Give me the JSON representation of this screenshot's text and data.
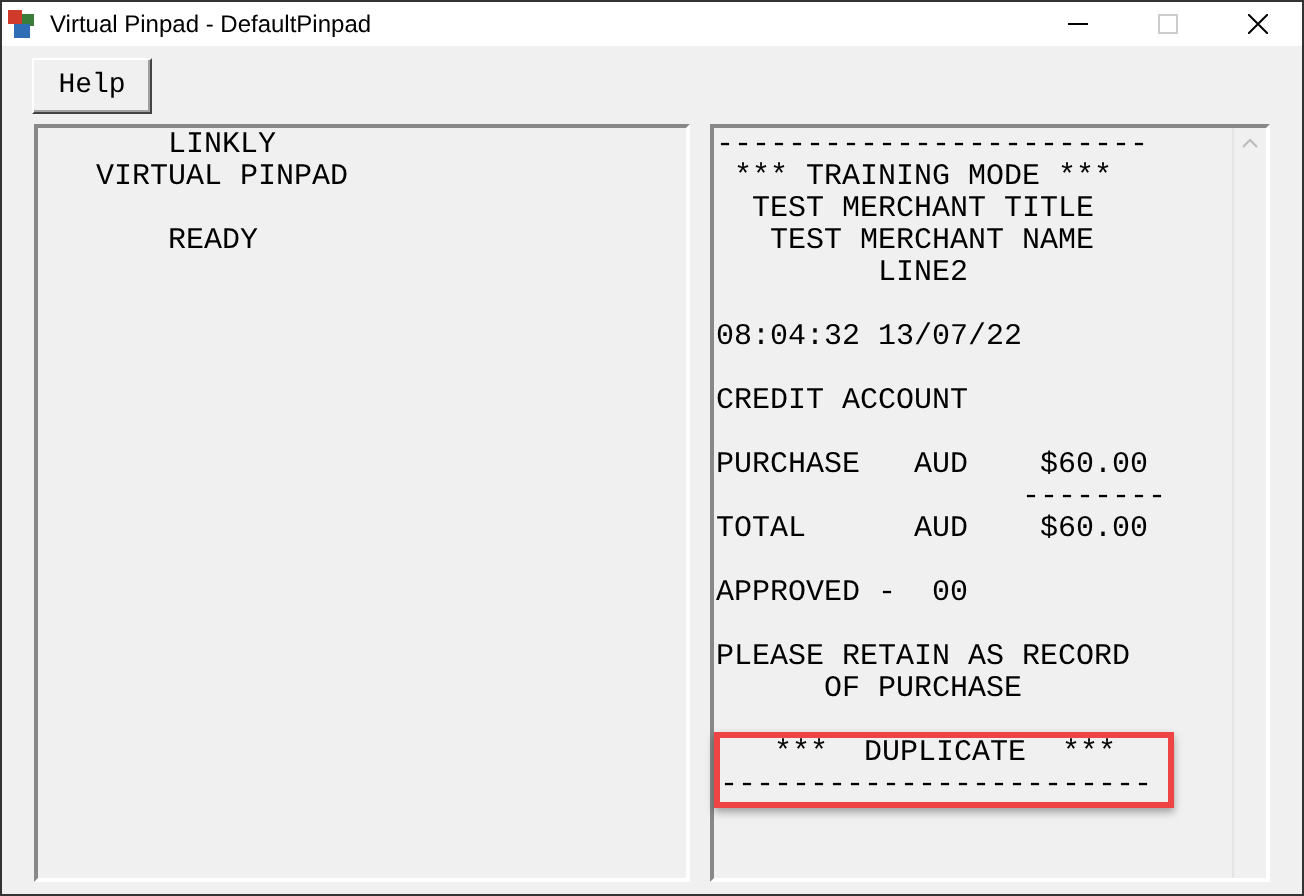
{
  "window": {
    "title": "Virtual Pinpad - DefaultPinpad"
  },
  "menu": {
    "help_button": "Help"
  },
  "display": {
    "blocks": [
      {
        "lines": [
          "       LINKLY",
          "   VIRTUAL PINPAD"
        ]
      },
      {
        "lines": [
          "       READY"
        ]
      }
    ]
  },
  "receipt": {
    "blocks": [
      {
        "highlighted": false,
        "lines": [
          "------------------------",
          " *** TRAINING MODE ***",
          "  TEST MERCHANT TITLE",
          "   TEST MERCHANT NAME",
          "         LINE2"
        ]
      },
      {
        "highlighted": false,
        "lines": [
          "08:04:32 13/07/22"
        ]
      },
      {
        "highlighted": false,
        "lines": [
          "CREDIT ACCOUNT"
        ]
      },
      {
        "highlighted": false,
        "lines": [
          "PURCHASE   AUD    $60.00",
          "                 --------",
          "TOTAL      AUD    $60.00"
        ]
      },
      {
        "highlighted": false,
        "lines": [
          "APPROVED -  00"
        ]
      },
      {
        "highlighted": false,
        "lines": [
          "PLEASE RETAIN AS RECORD",
          "      OF PURCHASE"
        ]
      },
      {
        "highlighted": true,
        "lines": [
          "   ***  DUPLICATE  ***",
          "------------------------"
        ]
      }
    ]
  }
}
